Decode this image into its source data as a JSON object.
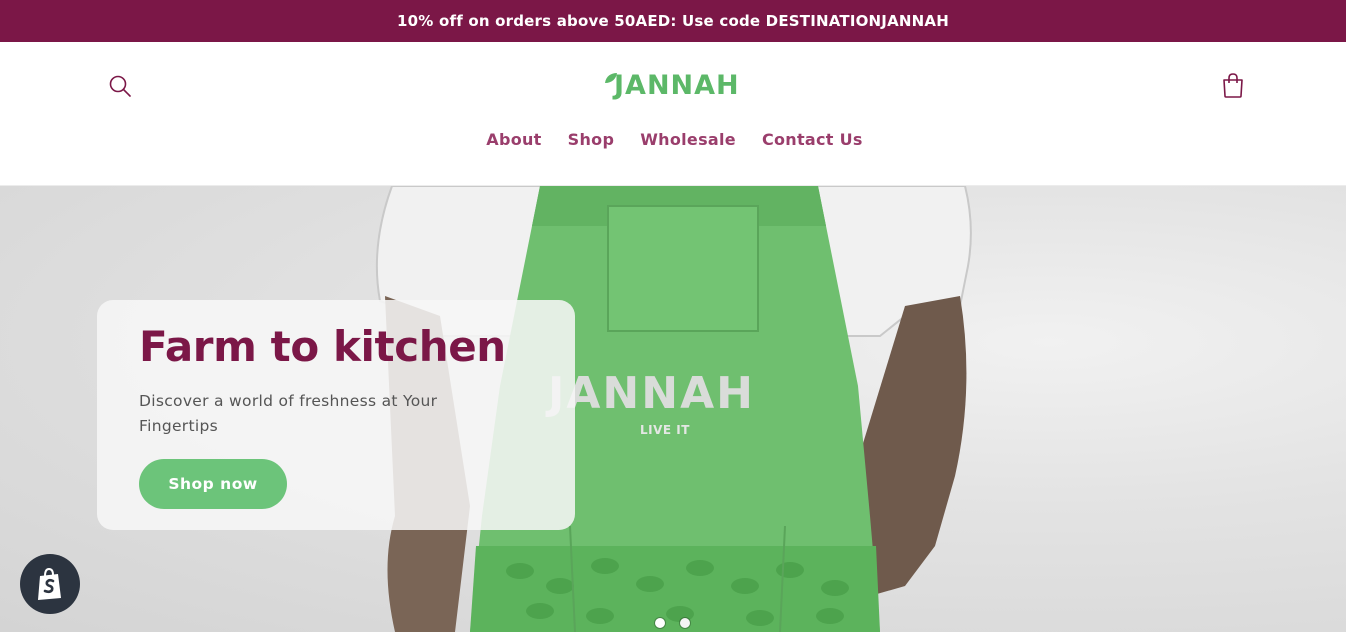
{
  "announcement": {
    "text": "10% off on orders above 50AED: Use code DESTINATIONJANNAH"
  },
  "header": {
    "logo_text": "JANNAH",
    "search_icon": "search-icon",
    "cart_icon": "cart-bag-icon",
    "nav": [
      {
        "label": "About"
      },
      {
        "label": "Shop"
      },
      {
        "label": "Wholesale"
      },
      {
        "label": "Contact Us"
      }
    ]
  },
  "hero": {
    "heading": "Farm to kitchen",
    "subheading": "Discover a world of freshness at Your Fingertips",
    "cta_label": "Shop now",
    "apron_brand": "JANNAH",
    "apron_tagline": "LIVE IT",
    "slides": {
      "total": 2,
      "current": 1
    }
  },
  "shopify_badge": {
    "icon": "shopify-bag-icon"
  },
  "colors": {
    "brand_maroon": "#7b1747",
    "nav_text": "#9a3e6c",
    "accent_green": "#6cc47a",
    "logo_green": "#5cb868",
    "body_text": "#555555",
    "apron_green": "#6fbf6f"
  }
}
